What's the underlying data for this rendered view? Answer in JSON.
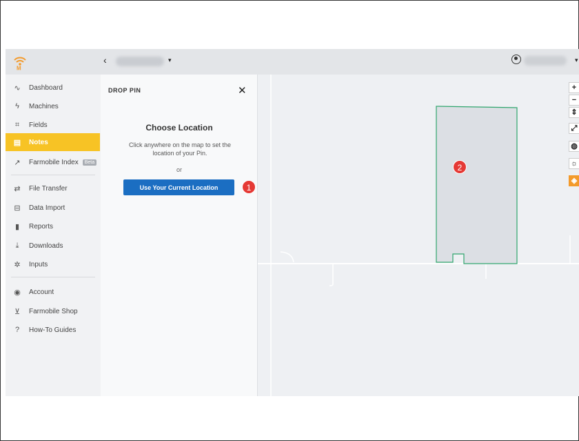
{
  "app": {
    "back_icon": "chevron-left-icon",
    "org_caret": "▾",
    "user_caret": "▾"
  },
  "sidebar": {
    "items": [
      {
        "label": "Dashboard",
        "icon": "pulse-icon",
        "glyph": "∿"
      },
      {
        "label": "Machines",
        "icon": "bolt-icon",
        "glyph": "ϟ"
      },
      {
        "label": "Fields",
        "icon": "field-icon",
        "glyph": "⌗"
      },
      {
        "label": "Notes",
        "icon": "note-icon",
        "glyph": "▤"
      },
      {
        "label": "Farmobile Index",
        "icon": "trend-icon",
        "glyph": "↗",
        "badge": "Beta"
      },
      {
        "label": "File Transfer",
        "icon": "transfer-icon",
        "glyph": "⇄"
      },
      {
        "label": "Data Import",
        "icon": "import-icon",
        "glyph": "⊟"
      },
      {
        "label": "Reports",
        "icon": "bar-chart-icon",
        "glyph": "▮"
      },
      {
        "label": "Downloads",
        "icon": "download-icon",
        "glyph": "⤓"
      },
      {
        "label": "Inputs",
        "icon": "inputs-icon",
        "glyph": "✲"
      },
      {
        "label": "Account",
        "icon": "account-icon",
        "glyph": "◉"
      },
      {
        "label": "Farmobile Shop",
        "icon": "cart-icon",
        "glyph": "⊻"
      },
      {
        "label": "How-To Guides",
        "icon": "help-icon",
        "glyph": "?"
      }
    ],
    "active": "Notes",
    "accent_color": "#f7c325"
  },
  "panel": {
    "title": "DROP PIN",
    "close": "✕",
    "heading": "Choose Location",
    "instruction": "Click anywhere on the map to set the location of your Pin.",
    "or": "or",
    "button": "Use Your Current Location",
    "button_color": "#1b6ec2"
  },
  "annotations": [
    {
      "num": "1"
    },
    {
      "num": "2"
    }
  ],
  "map_controls": [
    {
      "glyph": "+",
      "icon": "zoom-in-icon"
    },
    {
      "glyph": "−",
      "icon": "zoom-out-icon"
    },
    {
      "glyph": "⇕",
      "icon": "compass-icon"
    },
    {
      "glyph": "⤢",
      "icon": "fullscreen-icon"
    },
    {
      "glyph": "◍",
      "icon": "globe-icon"
    },
    {
      "glyph": "☼",
      "icon": "weather-icon"
    },
    {
      "glyph": "◈",
      "icon": "layers-icon"
    }
  ],
  "colors": {
    "field_outline": "#2ea56c",
    "badge": "#e53935",
    "layers_button": "#f39a2b"
  }
}
